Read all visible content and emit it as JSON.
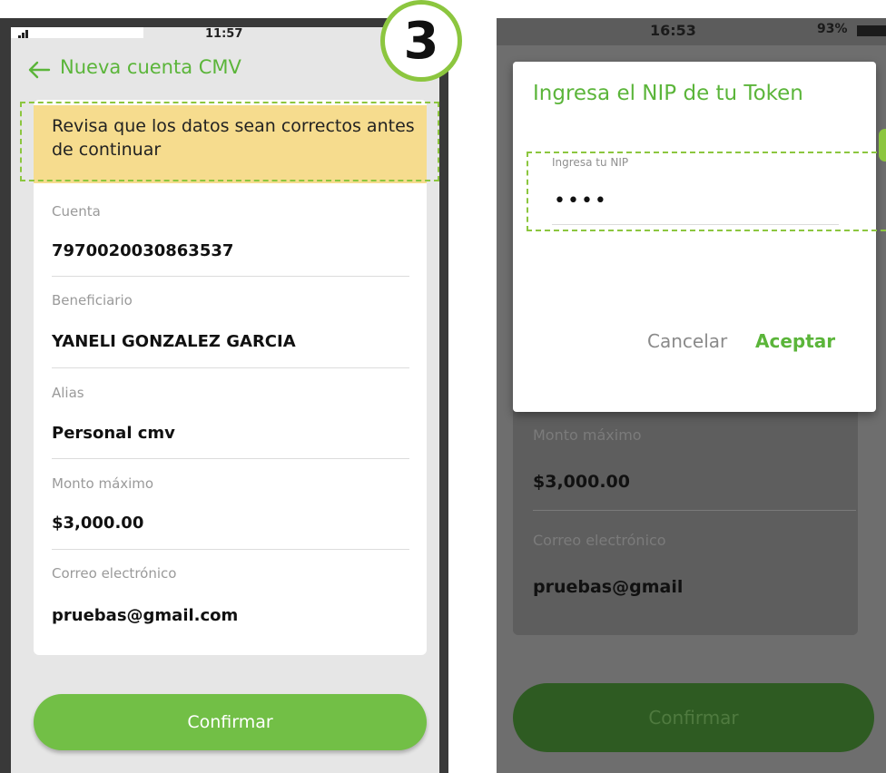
{
  "step_badge": "3",
  "left_screen": {
    "status_time": "11:57",
    "nav_title": "Nueva cuenta CMV",
    "warning": "Revisa que los datos sean correctos antes de continuar",
    "fields": [
      {
        "label": "Cuenta",
        "value": "7970020030863537"
      },
      {
        "label": "Beneficiario",
        "value": "YANELI GONZALEZ GARCIA"
      },
      {
        "label": "Alias",
        "value": "Personal cmv"
      },
      {
        "label": "Monto máximo",
        "value": "$3,000.00"
      },
      {
        "label": "Correo electrónico",
        "value": "pruebas@gmail.com"
      }
    ],
    "confirm_label": "Confirmar"
  },
  "right_screen": {
    "status_time": "16:53",
    "battery_level": "93%",
    "fields": [
      {
        "label": "Monto máximo",
        "value": "$3,000.00"
      },
      {
        "label": "Correo electrónico",
        "value": "pruebas@gmail"
      }
    ],
    "confirm_label": "Confirmar",
    "dialog": {
      "title": "Ingresa el NIP de tu Token",
      "input_label": "Ingresa tu NIP",
      "input_value": "••••",
      "cancel_label": "Cancelar",
      "accept_label": "Aceptar"
    }
  },
  "colors": {
    "brand_green": "#5bb53a",
    "button_green": "#72bf46",
    "highlight_dash": "#8cc63f",
    "warning_bg": "#f6dc8e"
  }
}
